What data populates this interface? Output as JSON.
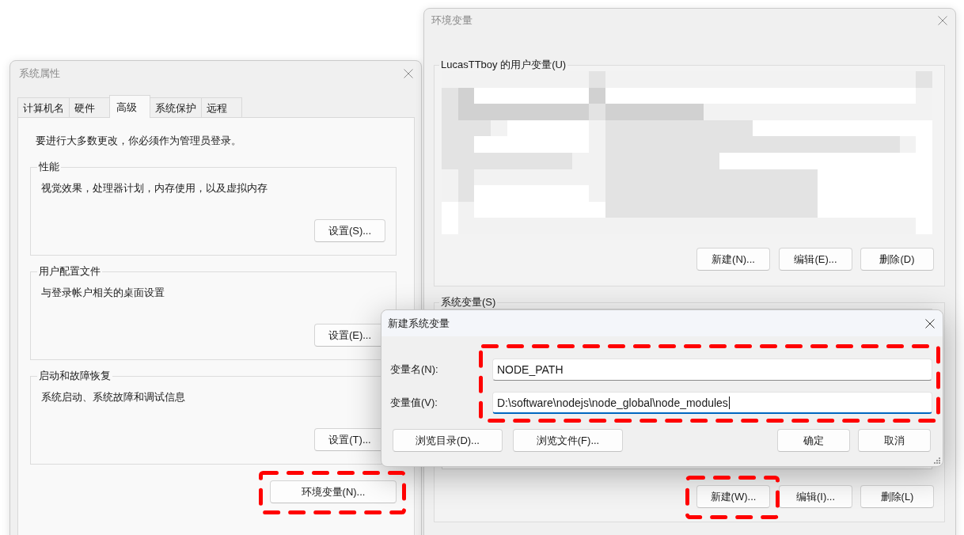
{
  "system_properties": {
    "title": "系统属性",
    "active": false,
    "tabs": [
      {
        "label": "计算机名",
        "selected": false
      },
      {
        "label": "硬件",
        "selected": false
      },
      {
        "label": "高级",
        "selected": true
      },
      {
        "label": "系统保护",
        "selected": false
      },
      {
        "label": "远程",
        "selected": false
      }
    ],
    "notice": "要进行大多数更改，你必须作为管理员登录。",
    "groups": [
      {
        "title": "性能",
        "description": "视觉效果，处理器计划，内存使用，以及虚拟内存",
        "button": "设置(S)..."
      },
      {
        "title": "用户配置文件",
        "description": "与登录帐户相关的桌面设置",
        "button": "设置(E)..."
      },
      {
        "title": "启动和故障恢复",
        "description": "系统启动、系统故障和调试信息",
        "button": "设置(T)..."
      }
    ],
    "env_button": {
      "label": "环境变量(N)...",
      "highlighted": true
    }
  },
  "environment_variables": {
    "title": "环境变量",
    "active": false,
    "user_group": {
      "title": "LucasTTboy 的用户变量(U)",
      "buttons": [
        {
          "label": "新建(N)...",
          "highlighted": false
        },
        {
          "label": "编辑(E)...",
          "highlighted": false
        },
        {
          "label": "删除(D)",
          "highlighted": false
        }
      ]
    },
    "system_group": {
      "title": "系统变量(S)",
      "buttons": [
        {
          "label": "新建(W)...",
          "highlighted": true
        },
        {
          "label": "编辑(I)...",
          "highlighted": false
        },
        {
          "label": "删除(L)",
          "highlighted": false
        }
      ]
    }
  },
  "new_variable_dialog": {
    "title": "新建系统变量",
    "active": true,
    "fields_highlighted": true,
    "fields": [
      {
        "label": "变量名(N):",
        "value": "NODE_PATH",
        "focused": false
      },
      {
        "label": "变量值(V):",
        "value": "D:\\software\\nodejs\\node_global\\node_modules",
        "focused": true
      }
    ],
    "browse_buttons": [
      "浏览目录(D)...",
      "浏览文件(F)..."
    ],
    "action_buttons": [
      "确定",
      "取消"
    ]
  }
}
